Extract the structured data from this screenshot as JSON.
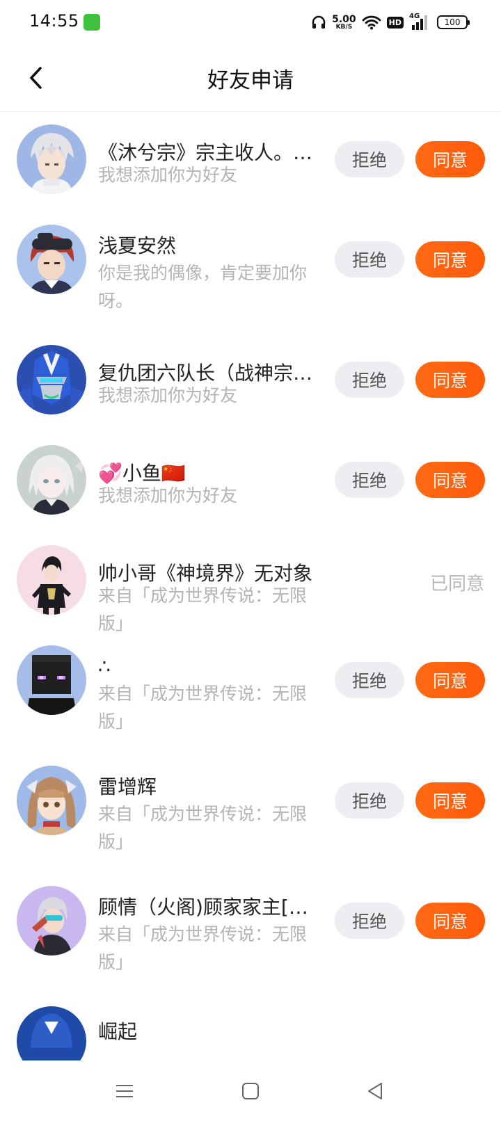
{
  "status_bar": {
    "time": "14:55",
    "net_speed_value": "5.00",
    "net_speed_unit": "KB/S",
    "hd_label": "HD",
    "network_label": "4G",
    "battery_level": "100"
  },
  "header": {
    "title": "好友申请"
  },
  "buttons": {
    "reject_label": "拒绝",
    "accept_label": "同意"
  },
  "requests": [
    {
      "name": "《沐兮宗》宗主收人。…",
      "message": "我想添加你为好友",
      "status": "pending"
    },
    {
      "name": "浅夏安然",
      "message": "你是我的偶像，肯定要加你呀。",
      "status": "pending"
    },
    {
      "name": "复仇团六队长（战神宗…",
      "message": "我想添加你为好友",
      "status": "pending"
    },
    {
      "name": "💞小鱼🇨🇳",
      "message": "我想添加你为好友",
      "status": "pending"
    },
    {
      "name": "帅小哥《神境界》无对象",
      "message": "来自「成为世界传说：无限版」",
      "status": "accepted",
      "status_label": "已同意"
    },
    {
      "name": "∴",
      "message": "来自「成为世界传说：无限版」",
      "status": "pending"
    },
    {
      "name": "雷增辉",
      "message": "来自「成为世界传说：无限版」",
      "status": "pending"
    },
    {
      "name": "顾情（火阁)顾家家主[…",
      "message": "来自「成为世界传说：无限版」",
      "status": "pending"
    },
    {
      "name": "崛起",
      "message": "",
      "status": "pending"
    }
  ],
  "colors": {
    "accent": "#ff6a14",
    "reject_bg": "#eceef2",
    "muted_text": "#b4b4b4"
  }
}
